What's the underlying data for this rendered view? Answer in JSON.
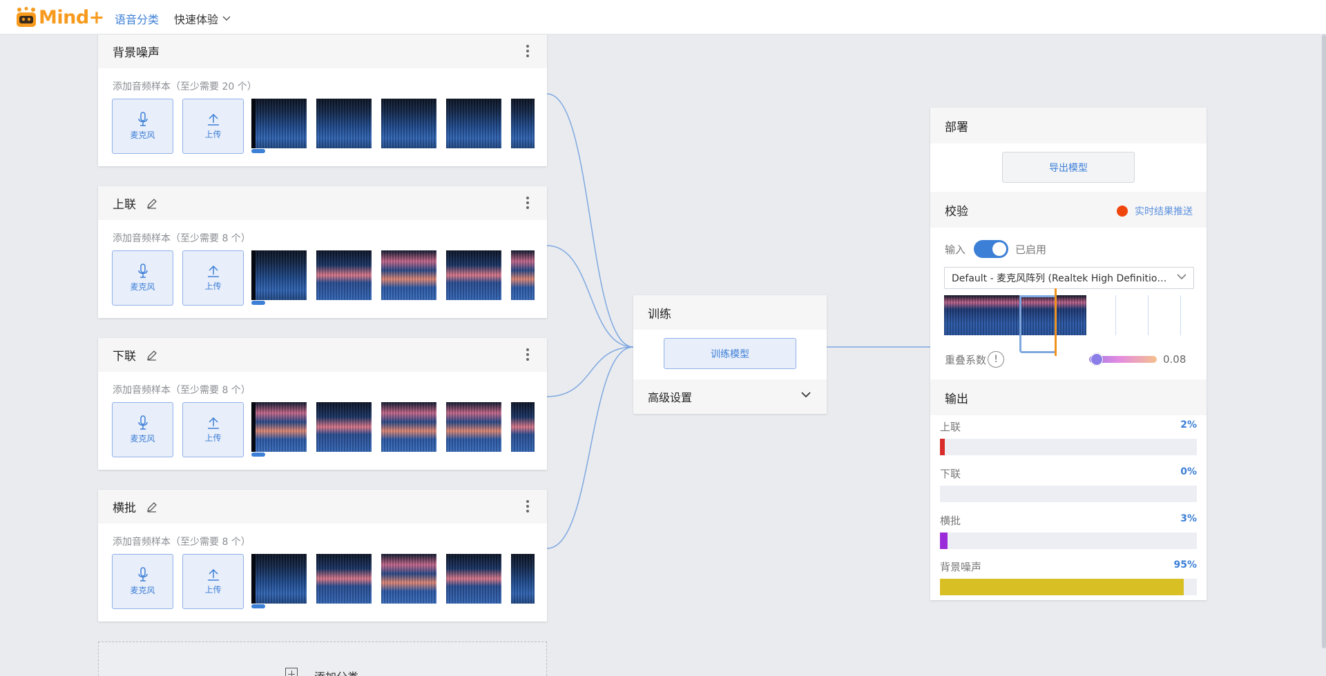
{
  "header": {
    "logo_text": "Mind+",
    "nav": [
      {
        "label": "语音分类",
        "active": true
      },
      {
        "label": "快速体验",
        "active": false
      }
    ]
  },
  "classes": [
    {
      "name": "背景噪声",
      "editable": false,
      "hint": "添加音频样本（至少需要 20 个）",
      "mic_label": "麦克风",
      "upload_label": "上传"
    },
    {
      "name": "上联",
      "editable": true,
      "hint": "添加音频样本（至少需要 8 个）",
      "mic_label": "麦克风",
      "upload_label": "上传"
    },
    {
      "name": "下联",
      "editable": true,
      "hint": "添加音频样本（至少需要 8 个）",
      "mic_label": "麦克风",
      "upload_label": "上传"
    },
    {
      "name": "横批",
      "editable": true,
      "hint": "添加音频样本（至少需要 8 个）",
      "mic_label": "麦克风",
      "upload_label": "上传"
    }
  ],
  "add_class": {
    "label": "添加分类"
  },
  "training": {
    "title": "训练",
    "train_button": "训练模型",
    "advanced": "高级设置"
  },
  "deploy": {
    "title": "部署",
    "export_button": "导出模型",
    "verify_title": "校验",
    "live_push": "实时结果推送",
    "input_label": "输入",
    "input_state": "已启用",
    "device": "Default - 麦克风阵列 (Realtek High Definitio…",
    "overlap_label": "重叠系数",
    "overlap_value": "0.08",
    "output_title": "输出",
    "outputs": [
      {
        "name": "上联",
        "percent": "2%",
        "value": 0.02,
        "color": "#d92b2b"
      },
      {
        "name": "下联",
        "percent": "0%",
        "value": 0.0,
        "color": "#3c7fd6"
      },
      {
        "name": "横批",
        "percent": "3%",
        "value": 0.03,
        "color": "#9a2bd9"
      },
      {
        "name": "背景噪声",
        "percent": "95%",
        "value": 0.95,
        "color": "#d8bf24"
      }
    ]
  },
  "colors": {
    "accent": "#3c7fd6",
    "brand": "#f79a1e",
    "live_dot": "#f0460e",
    "connector": "#7fa8e0"
  }
}
